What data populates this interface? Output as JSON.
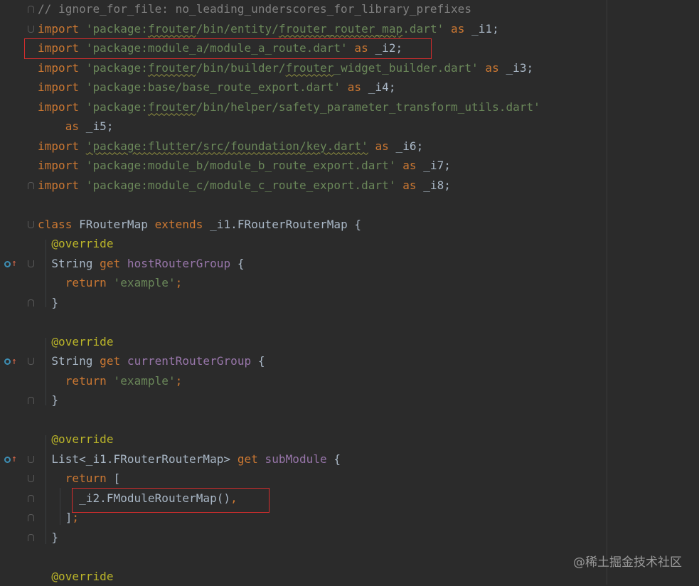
{
  "editor": {
    "lines": [
      {
        "tokens": [
          {
            "t": "// ignore_for_file: no_leading_underscores_for_library_prefixes",
            "c": "cmt"
          }
        ]
      },
      {
        "tokens": [
          {
            "t": "import ",
            "c": "kw"
          },
          {
            "t": "'package:",
            "c": "str"
          },
          {
            "t": "frouter",
            "c": "str squig"
          },
          {
            "t": "/bin/entity/",
            "c": "str"
          },
          {
            "t": "frouter_router_map",
            "c": "str squig"
          },
          {
            "t": ".dart'",
            "c": "str"
          },
          {
            "t": " as ",
            "c": "kw"
          },
          {
            "t": "_i1;",
            "c": "plain"
          }
        ]
      },
      {
        "tokens": [
          {
            "t": "import ",
            "c": "kw"
          },
          {
            "t": "'package:module_a/module_a_route.dart'",
            "c": "str"
          },
          {
            "t": " as ",
            "c": "kw"
          },
          {
            "t": "_i2;",
            "c": "plain"
          }
        ]
      },
      {
        "tokens": [
          {
            "t": "import ",
            "c": "kw"
          },
          {
            "t": "'package:",
            "c": "str"
          },
          {
            "t": "frouter",
            "c": "str squig"
          },
          {
            "t": "/bin/builder/",
            "c": "str"
          },
          {
            "t": "frouter",
            "c": "str squig"
          },
          {
            "t": "_widget_builder.dart'",
            "c": "str"
          },
          {
            "t": " as ",
            "c": "kw"
          },
          {
            "t": "_i3;",
            "c": "plain"
          }
        ]
      },
      {
        "tokens": [
          {
            "t": "import ",
            "c": "kw"
          },
          {
            "t": "'package:base/base_route_export.dart'",
            "c": "str"
          },
          {
            "t": " as ",
            "c": "kw"
          },
          {
            "t": "_i4;",
            "c": "plain"
          }
        ]
      },
      {
        "tokens": [
          {
            "t": "import ",
            "c": "kw"
          },
          {
            "t": "'package:",
            "c": "str"
          },
          {
            "t": "frouter",
            "c": "str squig"
          },
          {
            "t": "/bin/helper/safety_parameter_transform_utils.dart'",
            "c": "str"
          }
        ]
      },
      {
        "tokens": [
          {
            "t": "    as ",
            "c": "kw"
          },
          {
            "t": "_i5;",
            "c": "plain"
          }
        ]
      },
      {
        "tokens": [
          {
            "t": "import ",
            "c": "kw"
          },
          {
            "t": "'package:flutter/src/foundation/key.dart'",
            "c": "str squig"
          },
          {
            "t": " as ",
            "c": "kw"
          },
          {
            "t": "_i6;",
            "c": "plain"
          }
        ]
      },
      {
        "tokens": [
          {
            "t": "import ",
            "c": "kw"
          },
          {
            "t": "'package:module_b/module_b_route_export.dart'",
            "c": "str"
          },
          {
            "t": " as ",
            "c": "kw"
          },
          {
            "t": "_i7;",
            "c": "plain"
          }
        ]
      },
      {
        "tokens": [
          {
            "t": "import ",
            "c": "kw"
          },
          {
            "t": "'package:module_c/module_c_route_export.dart'",
            "c": "str"
          },
          {
            "t": " as ",
            "c": "kw"
          },
          {
            "t": "_i8;",
            "c": "plain"
          }
        ]
      },
      {
        "tokens": []
      },
      {
        "tokens": [
          {
            "t": "class ",
            "c": "kw"
          },
          {
            "t": "FRouterMap ",
            "c": "plain"
          },
          {
            "t": "extends ",
            "c": "kw"
          },
          {
            "t": "_i1.FRouterRouterMap {",
            "c": "plain"
          }
        ]
      },
      {
        "tokens": [
          {
            "t": "  @override",
            "c": "ann"
          }
        ]
      },
      {
        "tokens": [
          {
            "t": "  String ",
            "c": "plain"
          },
          {
            "t": "get ",
            "c": "kw"
          },
          {
            "t": "hostRouterGroup",
            "c": "fn"
          },
          {
            "t": " {",
            "c": "plain"
          }
        ]
      },
      {
        "tokens": [
          {
            "t": "    return ",
            "c": "kw"
          },
          {
            "t": "'example'",
            "c": "str"
          },
          {
            "t": ";",
            "c": "kw"
          }
        ]
      },
      {
        "tokens": [
          {
            "t": "  }",
            "c": "plain"
          }
        ]
      },
      {
        "tokens": []
      },
      {
        "tokens": [
          {
            "t": "  @override",
            "c": "ann"
          }
        ]
      },
      {
        "tokens": [
          {
            "t": "  String ",
            "c": "plain"
          },
          {
            "t": "get ",
            "c": "kw"
          },
          {
            "t": "currentRouterGroup",
            "c": "fn"
          },
          {
            "t": " {",
            "c": "plain"
          }
        ]
      },
      {
        "tokens": [
          {
            "t": "    return ",
            "c": "kw"
          },
          {
            "t": "'example'",
            "c": "str"
          },
          {
            "t": ";",
            "c": "kw"
          }
        ]
      },
      {
        "tokens": [
          {
            "t": "  }",
            "c": "plain"
          }
        ]
      },
      {
        "tokens": []
      },
      {
        "tokens": [
          {
            "t": "  @override",
            "c": "ann"
          }
        ]
      },
      {
        "tokens": [
          {
            "t": "  List<_i1.FRouterRouterMap> ",
            "c": "plain"
          },
          {
            "t": "get ",
            "c": "kw"
          },
          {
            "t": "subModule",
            "c": "fn"
          },
          {
            "t": " {",
            "c": "plain"
          }
        ]
      },
      {
        "tokens": [
          {
            "t": "    return ",
            "c": "kw"
          },
          {
            "t": "[",
            "c": "plain"
          }
        ]
      },
      {
        "tokens": [
          {
            "t": "      _i2.FModuleRouterMap()",
            "c": "plain"
          },
          {
            "t": ",",
            "c": "kw"
          }
        ]
      },
      {
        "tokens": [
          {
            "t": "    ]",
            "c": "plain"
          },
          {
            "t": ";",
            "c": "kw"
          }
        ]
      },
      {
        "tokens": [
          {
            "t": "  }",
            "c": "plain"
          }
        ]
      },
      {
        "tokens": []
      },
      {
        "tokens": [
          {
            "t": "  @override",
            "c": "ann"
          }
        ]
      }
    ]
  },
  "watermark": "@稀土掘金技术社区",
  "icons": {
    "override": "override-method-icon",
    "fold": "fold-marker-icon"
  },
  "colors": {
    "background": "#2b2b2b",
    "keyword": "#cc7832",
    "string": "#6a8759",
    "comment": "#808080",
    "annotation": "#bbb529",
    "getter": "#9876aa",
    "highlight_box": "#d62d2d"
  }
}
